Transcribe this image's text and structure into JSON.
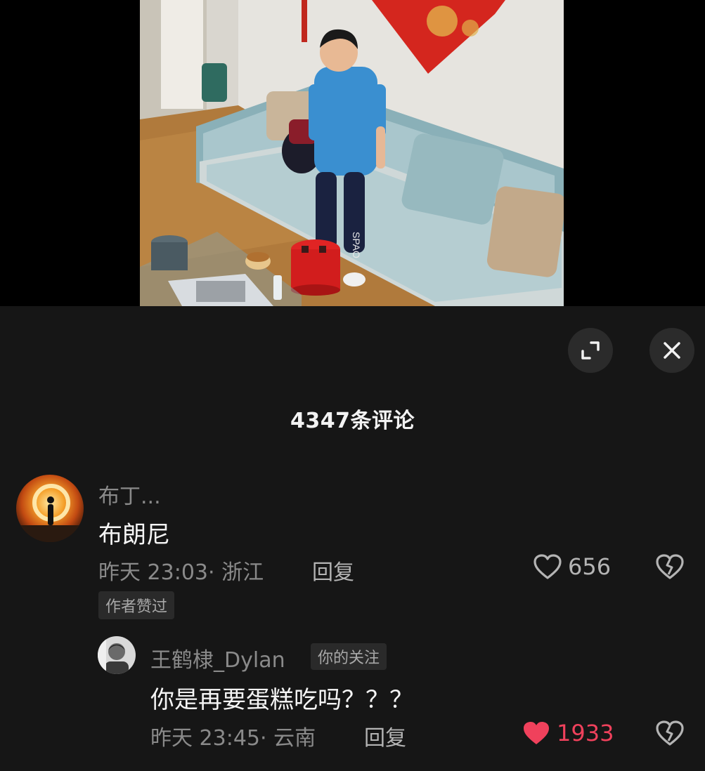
{
  "panel": {
    "comment_count": "4347条评论",
    "expand_icon": "expand-icon",
    "close_icon": "close-icon"
  },
  "comments": [
    {
      "username": "布丁...",
      "text": "布朗尼",
      "time_location": "昨天 23:03· 浙江",
      "reply_label": "回复",
      "likes": "656",
      "liked": false,
      "badge": "作者赞过",
      "avatar_icon": "sunset-avatar"
    },
    {
      "username": "王鹤棣_Dylan",
      "follow_badge": "你的关注",
      "text": "你是再要蛋糕吃吗？？？",
      "time_location": "昨天 23:45· 云南",
      "reply_label": "回复",
      "likes": "1933",
      "liked": true,
      "avatar_icon": "portrait-avatar"
    }
  ],
  "colors": {
    "panel_bg": "#161616",
    "liked_red": "#f0415c",
    "muted_text": "#8a8a8a"
  }
}
